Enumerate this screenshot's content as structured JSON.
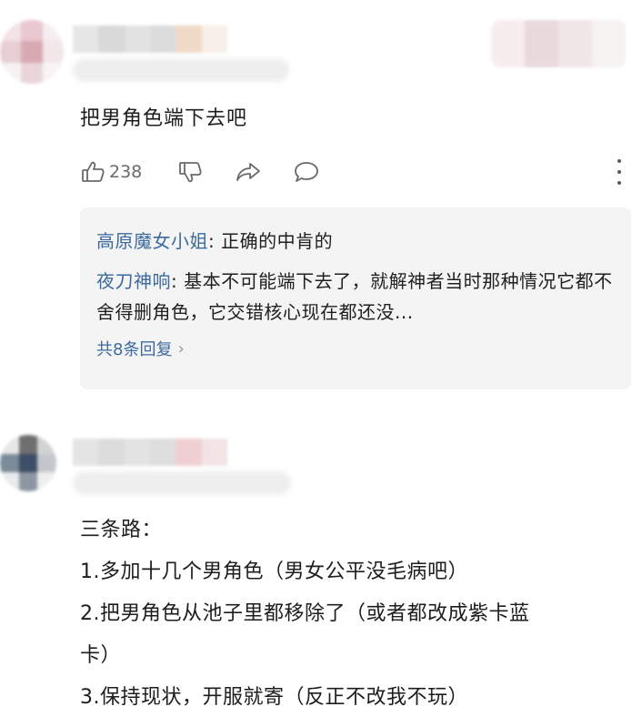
{
  "comments": [
    {
      "text": "把男角色端下去吧",
      "likes": "238",
      "replies": [
        {
          "author": "高原魔女小姐",
          "text": "正确的中肯的"
        },
        {
          "author": "夜刀神响",
          "text": "基本不可能端下去了，就解神者当时那种情况它都不舍得删角色，它交错核心现在都还没..."
        }
      ],
      "more_replies": "共8条回复",
      "icons": [
        "thumb-up-icon",
        "thumb-down-icon",
        "share-icon",
        "comment-bubble-icon",
        "more-vertical-icon"
      ]
    },
    {
      "lines": [
        "三条路：",
        "1.多加十几个男角色（男女公平没毛病吧）",
        "2.把男角色从池子里都移除了（或者都改成紫卡蓝",
        "卡）",
        "3.保持现状，开服就寄（反正不改我不玩）"
      ]
    }
  ],
  "colors": {
    "link": "#3d6a9e",
    "reply_bg": "#f4f4f4",
    "icon": "#6a6a6a"
  }
}
